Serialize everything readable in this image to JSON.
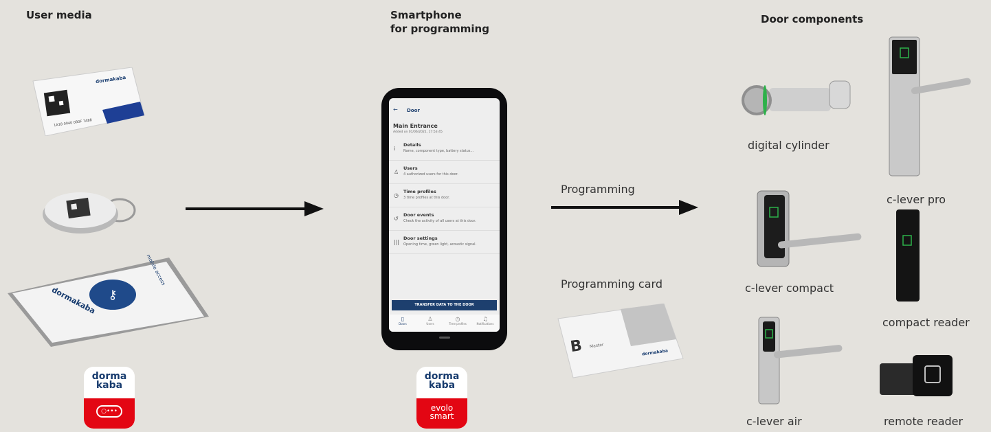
{
  "headers": {
    "user_media": "User media",
    "smartphone_line1": "Smartphone",
    "smartphone_line2": "for programming",
    "door_components": "Door components"
  },
  "arrows": {
    "programming": "Programming"
  },
  "programming_card": {
    "label": "Programming card",
    "letter": "B",
    "master": "Master",
    "brand": "dormakaba"
  },
  "user_card": {
    "brand": "dormakaba",
    "id": "1A18 0040 0B0F 7A88"
  },
  "mobile_phone": {
    "brand": "dormakaba",
    "title": "mobile access"
  },
  "app_logo_user": {
    "line1": "dorma",
    "line2": "kaba"
  },
  "app_logo_evolo": {
    "line1": "dorma",
    "line2": "kaba",
    "app1": "evolo",
    "app2": "smart"
  },
  "phone_screen": {
    "back": "←",
    "title": "Door",
    "door_name": "Main Entrance",
    "added": "Added on 01/06/2021, 17:53:45",
    "items": [
      {
        "icon": "i",
        "title": "Details",
        "sub": "Name, component type, battery status..."
      },
      {
        "icon": "♙",
        "title": "Users",
        "sub": "4 authorized users for this door."
      },
      {
        "icon": "◷",
        "title": "Time profiles",
        "sub": "3 time profiles at this door."
      },
      {
        "icon": "↺",
        "title": "Door events",
        "sub": "Check the activity of all users at this door."
      },
      {
        "icon": "|||",
        "title": "Door settings",
        "sub": "Opening time, green light, acoustic signal."
      }
    ],
    "transfer_button": "TRANSFER DATA TO THE DOOR",
    "tabs": [
      {
        "icon": "▯",
        "label": "Doors"
      },
      {
        "icon": "♙",
        "label": "Users"
      },
      {
        "icon": "◷",
        "label": "Time profiles"
      },
      {
        "icon": "♫",
        "label": "Notifications"
      }
    ]
  },
  "components": {
    "digital_cylinder": "digital cylinder",
    "c_lever_pro": "c-lever pro",
    "c_lever_compact": "c-lever compact",
    "compact_reader": "compact reader",
    "c_lever_air": "c-lever air",
    "remote_reader": "remote reader"
  },
  "colors": {
    "background": "#e4e2dd",
    "brand_red": "#e30613",
    "brand_blue": "#173b6e",
    "transfer_button": "#1d3f6e"
  }
}
